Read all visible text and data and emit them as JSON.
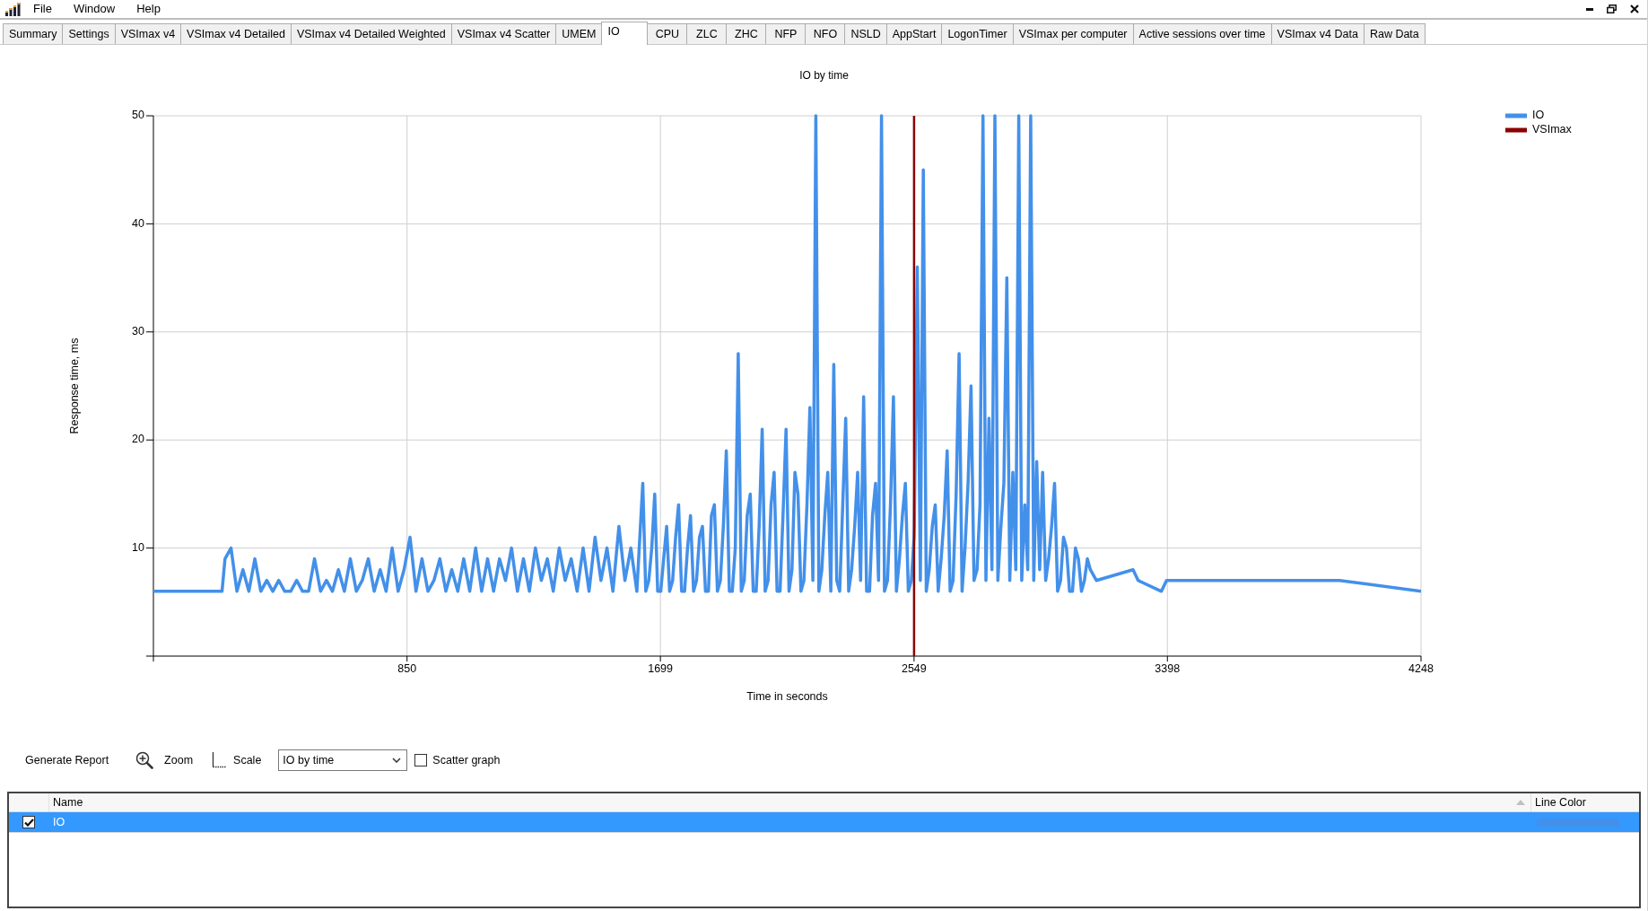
{
  "menu_bar": [
    "File",
    "Window",
    "Help"
  ],
  "tabs": [
    {
      "label": "Summary",
      "selected": false
    },
    {
      "label": "Settings",
      "selected": false
    },
    {
      "label": "VSImax v4",
      "selected": false
    },
    {
      "label": "VSImax v4 Detailed",
      "selected": false
    },
    {
      "label": "VSImax v4 Detailed Weighted",
      "selected": false
    },
    {
      "label": "VSImax v4 Scatter",
      "selected": false
    },
    {
      "label": "UMEM",
      "selected": false
    },
    {
      "label": "IO",
      "selected": true
    },
    {
      "label": "CPU",
      "selected": false
    },
    {
      "label": "ZLC",
      "selected": false
    },
    {
      "label": "ZHC",
      "selected": false
    },
    {
      "label": "NFP",
      "selected": false
    },
    {
      "label": "NFO",
      "selected": false
    },
    {
      "label": "NSLD",
      "selected": false
    },
    {
      "label": "AppStart",
      "selected": false
    },
    {
      "label": "LogonTimer",
      "selected": false
    },
    {
      "label": "VSImax per computer",
      "selected": false
    },
    {
      "label": "Active sessions over time",
      "selected": false
    },
    {
      "label": "VSImax v4 Data",
      "selected": false
    },
    {
      "label": "Raw Data",
      "selected": false
    }
  ],
  "chart_panel": {
    "chart_data": {
      "type": "line",
      "title": "IO by time",
      "xlabel": "Time in seconds",
      "ylabel": "Response time, ms",
      "x": [
        0,
        230,
        240,
        260,
        280,
        300,
        320,
        340,
        360,
        380,
        400,
        420,
        440,
        460,
        480,
        500,
        520,
        540,
        560,
        580,
        600,
        620,
        640,
        660,
        680,
        700,
        720,
        740,
        760,
        780,
        800,
        820,
        840,
        860,
        880,
        900,
        920,
        940,
        960,
        980,
        1000,
        1020,
        1040,
        1060,
        1080,
        1100,
        1120,
        1140,
        1160,
        1180,
        1200,
        1220,
        1240,
        1260,
        1280,
        1300,
        1320,
        1340,
        1360,
        1380,
        1400,
        1420,
        1440,
        1460,
        1480,
        1500,
        1520,
        1540,
        1560,
        1580,
        1600,
        1620,
        1640,
        1650,
        1660,
        1670,
        1680,
        1690,
        1700,
        1710,
        1720,
        1730,
        1740,
        1750,
        1760,
        1770,
        1780,
        1790,
        1800,
        1810,
        1820,
        1830,
        1840,
        1850,
        1860,
        1870,
        1880,
        1890,
        1900,
        1910,
        1920,
        1930,
        1940,
        1950,
        1960,
        1970,
        1980,
        1990,
        2000,
        2010,
        2020,
        2030,
        2040,
        2050,
        2060,
        2070,
        2080,
        2090,
        2100,
        2110,
        2120,
        2130,
        2140,
        2150,
        2160,
        2170,
        2180,
        2190,
        2200,
        2210,
        2220,
        2230,
        2240,
        2250,
        2260,
        2270,
        2280,
        2290,
        2300,
        2310,
        2320,
        2330,
        2340,
        2350,
        2360,
        2370,
        2380,
        2390,
        2400,
        2410,
        2420,
        2430,
        2440,
        2450,
        2460,
        2470,
        2480,
        2490,
        2500,
        2510,
        2520,
        2530,
        2540,
        2549,
        2549,
        2550,
        2560,
        2570,
        2580,
        2590,
        2600,
        2610,
        2620,
        2630,
        2640,
        2650,
        2660,
        2670,
        2680,
        2690,
        2700,
        2710,
        2720,
        2730,
        2740,
        2750,
        2760,
        2770,
        2780,
        2790,
        2800,
        2810,
        2820,
        2830,
        2840,
        2850,
        2860,
        2870,
        2880,
        2890,
        2900,
        2910,
        2920,
        2930,
        2940,
        2950,
        2960,
        2970,
        2980,
        2990,
        3000,
        3010,
        3020,
        3030,
        3040,
        3050,
        3060,
        3070,
        3080,
        3090,
        3100,
        3110,
        3120,
        3130,
        3140,
        3160,
        3283,
        3300,
        3378,
        3395,
        3975,
        4248
      ],
      "series": [
        {
          "name": "IO",
          "color": "#4390ea",
          "values": [
            6,
            6,
            9,
            10,
            6,
            8,
            6,
            9,
            6,
            7,
            6,
            7,
            6,
            6,
            7,
            6,
            6,
            9,
            6,
            7,
            6,
            8,
            6,
            9,
            6,
            7,
            9,
            6,
            8,
            6,
            10,
            6,
            8,
            11,
            6,
            9,
            6,
            7,
            9,
            6,
            8,
            6,
            9,
            6,
            10,
            6,
            9,
            6,
            9,
            7,
            10,
            6,
            9,
            6,
            10,
            7,
            9,
            6,
            10,
            7,
            9,
            6,
            10,
            6,
            11,
            7,
            10,
            6,
            12,
            7,
            10,
            6,
            16,
            6,
            7,
            10,
            15,
            6,
            6,
            9,
            12,
            6,
            7,
            11,
            14,
            6,
            6,
            10,
            13,
            6,
            7,
            11,
            12,
            6,
            6,
            13,
            14,
            6,
            7,
            12,
            19,
            6,
            6,
            10,
            28,
            6,
            7,
            13,
            15,
            6,
            6,
            12,
            21,
            6,
            7,
            14,
            17,
            6,
            6,
            13,
            21,
            6,
            8,
            17,
            15,
            6,
            7,
            14,
            23,
            7,
            50,
            6,
            8,
            13,
            17,
            6,
            27,
            7,
            6,
            14,
            22,
            6,
            8,
            12,
            17,
            7,
            24,
            6,
            6,
            13,
            16,
            7,
            50,
            6,
            7,
            14,
            24,
            6,
            9,
            13,
            16,
            6,
            7,
            11,
            11,
            12,
            36,
            7,
            45,
            6,
            8,
            12,
            14,
            6,
            9,
            13,
            19,
            6,
            7,
            15,
            28,
            6,
            10,
            16,
            25,
            7,
            8,
            14,
            50,
            7,
            22,
            8,
            50,
            7,
            12,
            16,
            35,
            7,
            17,
            8,
            50,
            7,
            14,
            8,
            50,
            7,
            18,
            8,
            17,
            7,
            9,
            12,
            16,
            6,
            7,
            11,
            10,
            6,
            6,
            10,
            9,
            6,
            7,
            9,
            8,
            7,
            8,
            7,
            6,
            7,
            7,
            6
          ]
        },
        {
          "name": "VSImax",
          "color": "#8b0000",
          "values": [
            null,
            null,
            null,
            null,
            null,
            null,
            null,
            null,
            null,
            null,
            null,
            null,
            null,
            null,
            null,
            null,
            null,
            null,
            null,
            null,
            null,
            null,
            null,
            null,
            null,
            null,
            null,
            null,
            null,
            null,
            null,
            null,
            null,
            null,
            null,
            null,
            null,
            null,
            null,
            null,
            null,
            null,
            null,
            null,
            null,
            null,
            null,
            null,
            null,
            null,
            null,
            null,
            null,
            null,
            null,
            null,
            null,
            null,
            null,
            null,
            null,
            null,
            null,
            null,
            null,
            null,
            null,
            null,
            null,
            null,
            null,
            null,
            null,
            null,
            null,
            null,
            null,
            null,
            null,
            null,
            null,
            null,
            null,
            null,
            null,
            null,
            null,
            null,
            null,
            null,
            null,
            null,
            null,
            null,
            null,
            null,
            null,
            null,
            null,
            null,
            null,
            null,
            null,
            null,
            null,
            null,
            null,
            null,
            null,
            null,
            null,
            null,
            null,
            null,
            null,
            null,
            null,
            null,
            null,
            null,
            null,
            null,
            null,
            null,
            null,
            null,
            null,
            null,
            null,
            null,
            null,
            null,
            null,
            null,
            null,
            null,
            null,
            null,
            null,
            null,
            null,
            null,
            null,
            null,
            null,
            null,
            null,
            null,
            null,
            null,
            null,
            null,
            null,
            null,
            null,
            null,
            null,
            null,
            null,
            null,
            null,
            null,
            null,
            0,
            50,
            null,
            null,
            null,
            null,
            null,
            null,
            null,
            null,
            null,
            null,
            null,
            null,
            null,
            null,
            null,
            null,
            null,
            null,
            null,
            null,
            null,
            null,
            null,
            null,
            null,
            null,
            null,
            null,
            null,
            null,
            null,
            null,
            null,
            null,
            null,
            null,
            null,
            null,
            null,
            null,
            null,
            null,
            null,
            null,
            null,
            null,
            null,
            null,
            null,
            null,
            null,
            null,
            null,
            null,
            null,
            null,
            null,
            null,
            null,
            null,
            null,
            null,
            null,
            null,
            null,
            null,
            null
          ]
        }
      ],
      "xlim": [
        0,
        4248
      ],
      "ylim": [
        0,
        50
      ],
      "xticks": [
        850,
        1699,
        2549,
        3398,
        4248
      ],
      "yticks": [
        10,
        20,
        30,
        40,
        50
      ],
      "grid": true,
      "legend": "right"
    }
  },
  "toolbar": {
    "generate_report": "Generate Report",
    "zoom": "Zoom",
    "scale": "Scale",
    "chart_select": {
      "value": "IO by time"
    },
    "scatter_graph": {
      "label": "Scatter graph",
      "checked": false
    }
  },
  "table": {
    "columns": [
      {
        "label": "Name",
        "sorted": true
      },
      {
        "label": "Line Color",
        "sorted": false
      }
    ],
    "rows": [
      {
        "name": "IO",
        "checked": true,
        "selected": true,
        "color": "#4390ea"
      }
    ]
  }
}
